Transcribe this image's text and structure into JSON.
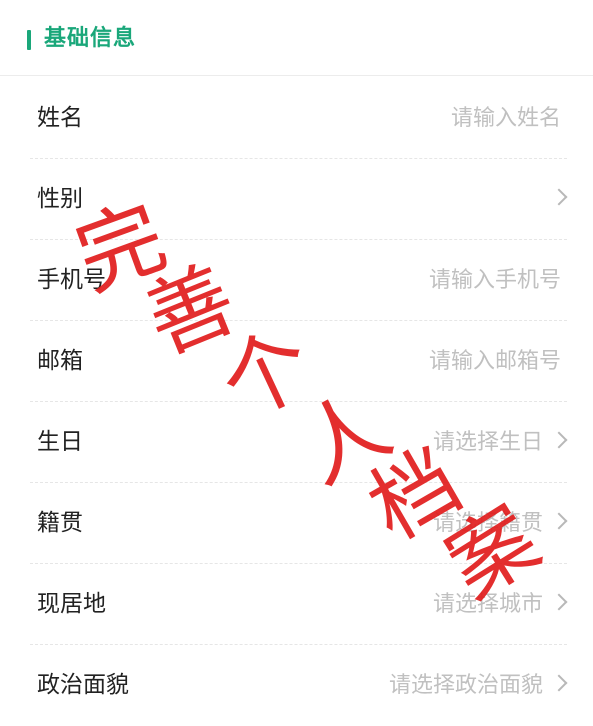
{
  "section": {
    "title": "基础信息"
  },
  "colors": {
    "accent": "#1aa77a",
    "stamp": "#e11d1d",
    "placeholder": "#c0c0c0"
  },
  "rows": [
    {
      "label": "姓名",
      "placeholder": "请输入姓名",
      "arrow": false
    },
    {
      "label": "性别",
      "placeholder": "",
      "arrow": true
    },
    {
      "label": "手机号",
      "placeholder": "请输入手机号",
      "arrow": false
    },
    {
      "label": "邮箱",
      "placeholder": "请输入邮箱号",
      "arrow": false
    },
    {
      "label": "生日",
      "placeholder": "请选择生日",
      "arrow": true
    },
    {
      "label": "籍贯",
      "placeholder": "请选择籍贯",
      "arrow": true
    },
    {
      "label": "现居地",
      "placeholder": "请选择城市",
      "arrow": true
    },
    {
      "label": "政治面貌",
      "placeholder": "请选择政治面貌",
      "arrow": true
    }
  ],
  "stamp": {
    "text": "完善个人档案",
    "chars": [
      "完",
      "善",
      "个",
      "人",
      "档",
      "案"
    ]
  }
}
